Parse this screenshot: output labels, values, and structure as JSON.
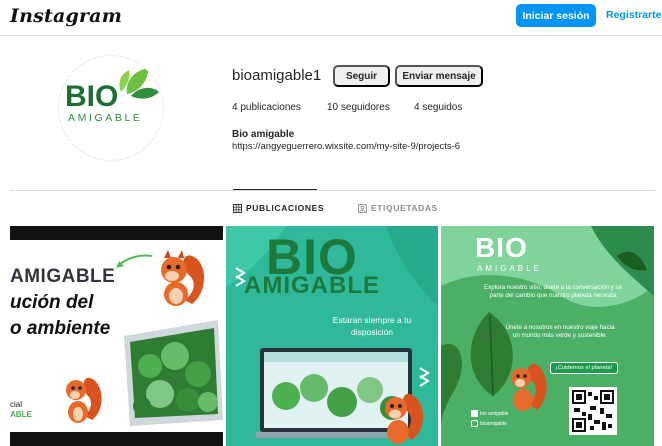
{
  "topbar": {
    "logo": "Instagram",
    "login_label": "Iniciar sesión",
    "signup_label": "Registrarte"
  },
  "profile": {
    "avatar": {
      "word1": "BIO",
      "word2": "AMIGABLE"
    },
    "username": "bioamigable1",
    "follow_label": "Seguir",
    "message_label": "Enviar mensaje",
    "stats": {
      "posts": "4 publicaciones",
      "followers": "10 seguidores",
      "following": "4 seguidos"
    },
    "full_name": "Bio amigable",
    "website": "https://angyeguerrero.wixsite.com/my-site-9/projects-6"
  },
  "tabs": [
    {
      "label": "PUBLICACIONES",
      "icon": "grid-icon",
      "active": true
    },
    {
      "label": "ETIQUETADAS",
      "icon": "tag-person-icon",
      "active": false
    }
  ],
  "posts": [
    {
      "line1": "AMIGABLE",
      "line2": "ución del",
      "line3": "o ambiente",
      "small1": "cial",
      "small2": "ABLE"
    },
    {
      "bio": "BIO",
      "amigable": "AMIGABLE",
      "tagline": "Estaran siempre a tu disposición"
    },
    {
      "bio": "BIO",
      "amigable": "AMIGABLE",
      "paragraph1": "Explora nuestro sitio, únete a la conversación y sé parte del cambio que nuestro planeta necesita",
      "paragraph2": "Únete a nosotros en nuestro viaje hacia un mundo más verde y sostenible.",
      "cta": "¡Cuidemos el planeta!",
      "social1": "bio amigable",
      "social2": "bioamigable"
    }
  ],
  "colors": {
    "primary_button": "#0095f6",
    "brand_green": "#1d7a3e",
    "teal_post": "#2fb89a",
    "green_post": "#5fc38a"
  }
}
